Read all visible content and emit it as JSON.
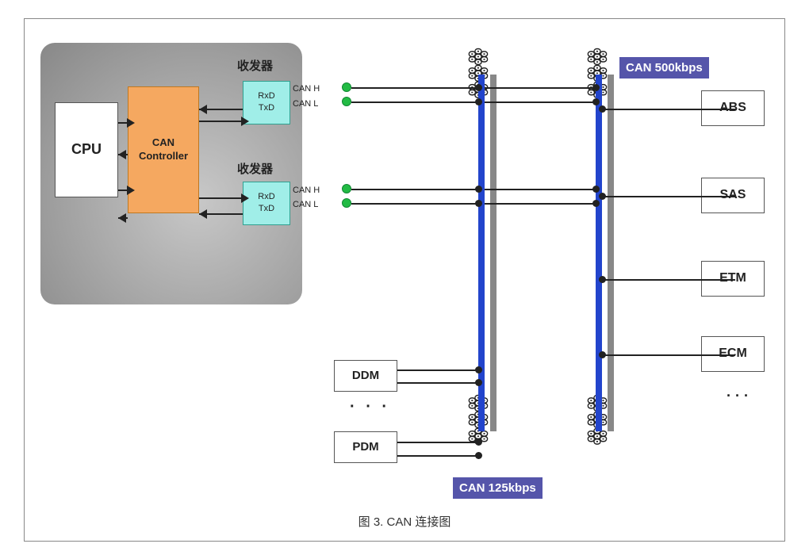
{
  "caption": "图 3.    CAN 连接图",
  "cpu_label": "CPU",
  "can_controller_label": "CAN\nController",
  "transceiver1_label": "收发器",
  "transceiver2_label": "收发器",
  "transceiver1_lines": [
    "RxD",
    "TxD"
  ],
  "transceiver2_lines": [
    "RxD",
    "TxD"
  ],
  "canh_label1": "CAN H",
  "canl_label1": "CAN L",
  "canh_label2": "CAN H",
  "canl_label2": "CAN L",
  "can_badge1": "CAN\n500kbps",
  "can_badge2": "CAN\n125kbps",
  "nodes": [
    "ABS",
    "SAS",
    "ETM",
    "ECM"
  ],
  "devices": [
    "DDM",
    "PDM"
  ],
  "ellipsis": "·  ·  ·"
}
